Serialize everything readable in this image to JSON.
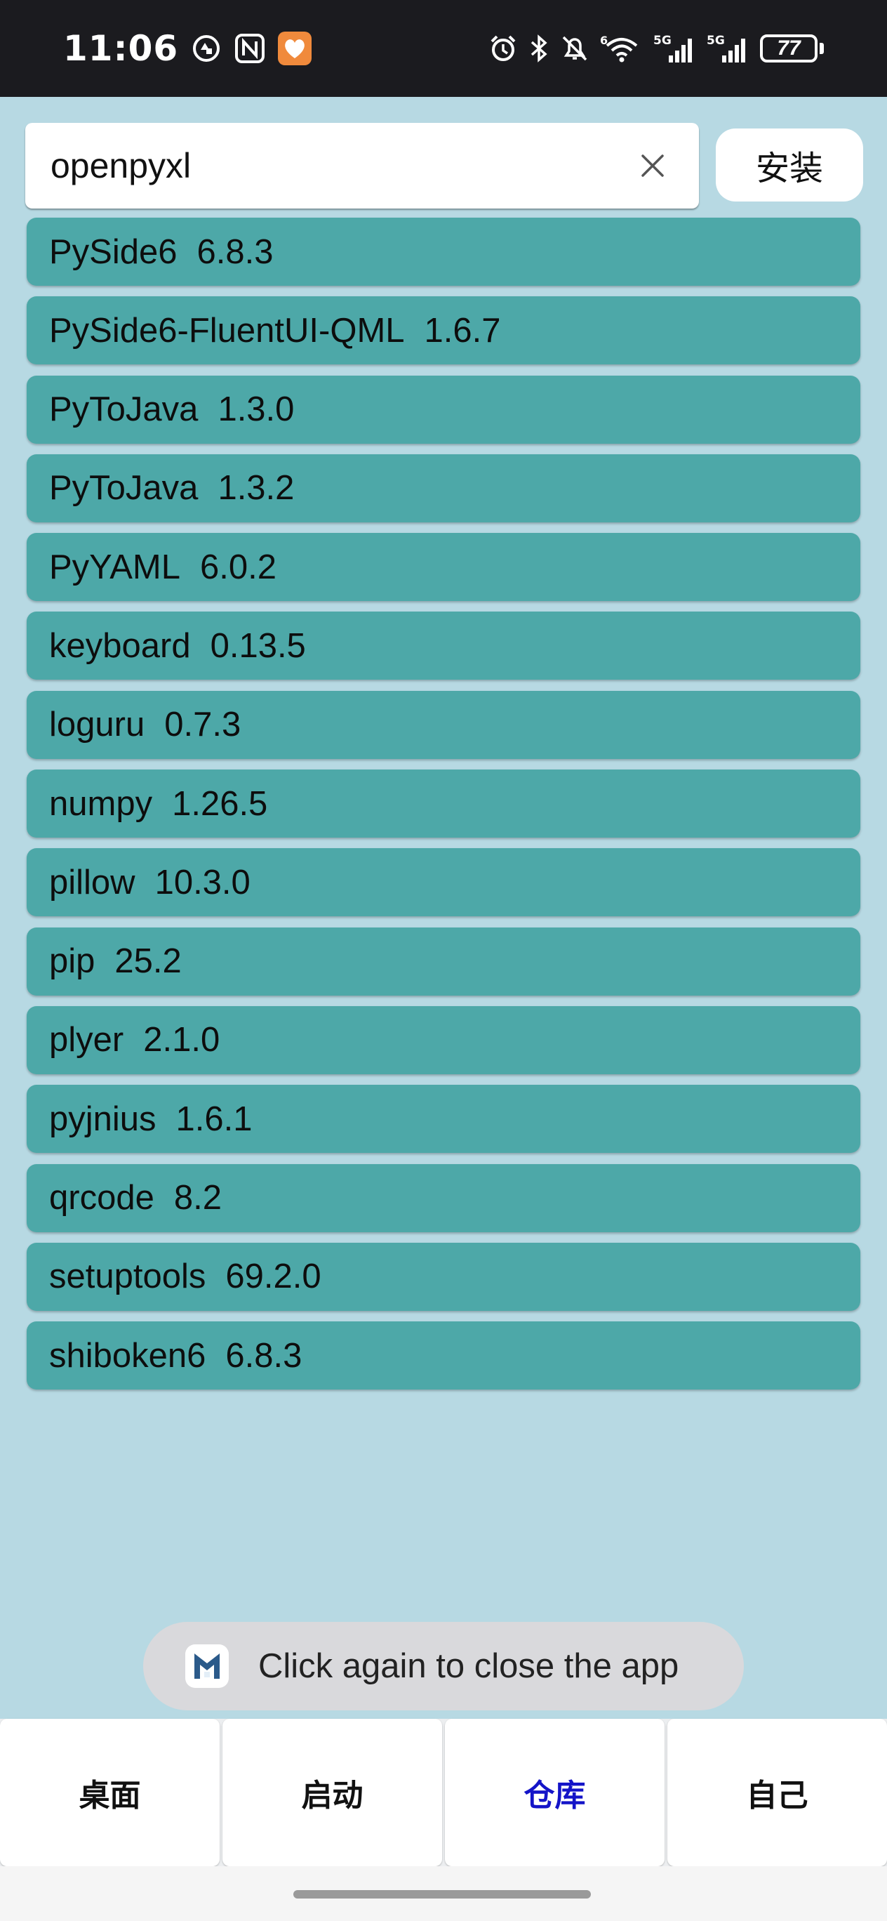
{
  "status_bar": {
    "time": "11:06",
    "battery": "77",
    "icons_left": [
      "data-saver-icon",
      "nfc-icon",
      "health-app-icon"
    ],
    "icons_right": [
      "alarm-icon",
      "bluetooth-icon",
      "mute-bell-icon",
      "wifi-icon",
      "signal-5g-1-icon",
      "signal-5g-2-icon",
      "battery-icon"
    ],
    "network_labels": [
      "6",
      "5G",
      "5G"
    ]
  },
  "search": {
    "value": "openpyxl",
    "clear_icon": "close-icon",
    "install_label": "安装"
  },
  "packages": [
    {
      "name": "PySide6",
      "version": "6.8.3"
    },
    {
      "name": "PySide6-FluentUI-QML",
      "version": "1.6.7"
    },
    {
      "name": "PyToJava",
      "version": "1.3.0"
    },
    {
      "name": "PyToJava",
      "version": "1.3.2"
    },
    {
      "name": "PyYAML",
      "version": "6.0.2"
    },
    {
      "name": "keyboard",
      "version": "0.13.5"
    },
    {
      "name": "loguru",
      "version": "0.7.3"
    },
    {
      "name": "numpy",
      "version": "1.26.5"
    },
    {
      "name": "pillow",
      "version": "10.3.0"
    },
    {
      "name": "pip",
      "version": "25.2"
    },
    {
      "name": "plyer",
      "version": "2.1.0"
    },
    {
      "name": "pyjnius",
      "version": "1.6.1"
    },
    {
      "name": "qrcode",
      "version": "8.2"
    },
    {
      "name": "setuptools",
      "version": "69.2.0"
    },
    {
      "name": "shiboken6",
      "version": "6.8.3"
    }
  ],
  "toast": {
    "icon": "app-logo-icon",
    "text": "Click again to close the app"
  },
  "nav": {
    "tabs": [
      {
        "label": "桌面",
        "active": false
      },
      {
        "label": "启动",
        "active": false
      },
      {
        "label": "仓库",
        "active": true
      },
      {
        "label": "自己",
        "active": false
      }
    ]
  },
  "colors": {
    "background": "#b7d9e3",
    "list_item": "#4da8a8",
    "active_tab": "#1414c8",
    "status_bar": "#1b1b1f"
  }
}
